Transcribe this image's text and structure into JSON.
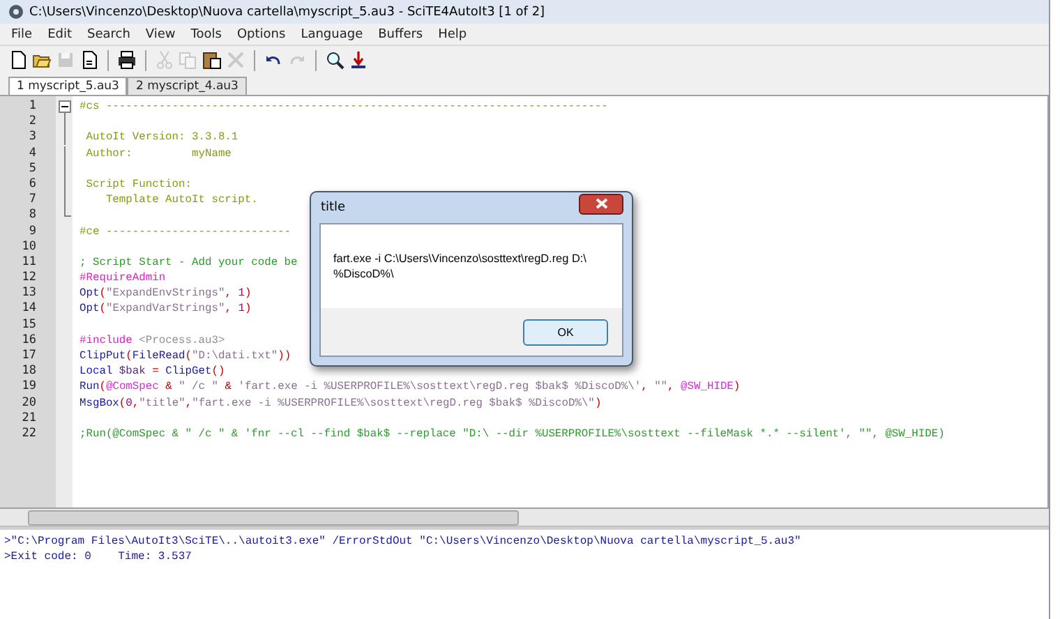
{
  "window": {
    "title": "C:\\Users\\Vincenzo\\Desktop\\Nuova cartella\\myscript_5.au3 - SciTE4AutoIt3 [1 of 2]"
  },
  "menu": [
    "File",
    "Edit",
    "Search",
    "View",
    "Tools",
    "Options",
    "Language",
    "Buffers",
    "Help"
  ],
  "toolbar": [
    {
      "kind": "new",
      "disabled": false
    },
    {
      "kind": "open",
      "disabled": false
    },
    {
      "kind": "save",
      "disabled": true
    },
    {
      "kind": "document",
      "disabled": false
    },
    {
      "kind": "separator"
    },
    {
      "kind": "print",
      "disabled": false
    },
    {
      "kind": "separator"
    },
    {
      "kind": "cut",
      "disabled": true
    },
    {
      "kind": "copy",
      "disabled": true
    },
    {
      "kind": "paste",
      "disabled": false
    },
    {
      "kind": "delete",
      "disabled": true
    },
    {
      "kind": "separator"
    },
    {
      "kind": "undo",
      "disabled": false
    },
    {
      "kind": "redo",
      "disabled": true
    },
    {
      "kind": "separator"
    },
    {
      "kind": "find",
      "disabled": false
    },
    {
      "kind": "compile",
      "disabled": false
    }
  ],
  "tabs": [
    {
      "label": "1 myscript_5.au3",
      "selected": true
    },
    {
      "label": "2 myscript_4.au3",
      "selected": false
    }
  ],
  "editor": {
    "lines": [
      {
        "number": "1",
        "kind": "fold_start",
        "expanded": true,
        "segments": [
          {
            "kind": "block",
            "text": "#cs ----------------------------------------------------------------------------"
          }
        ]
      },
      {
        "number": "2",
        "kind": "fold_body"
      },
      {
        "number": "3",
        "kind": "fold_body",
        "segments": [
          {
            "kind": "block",
            "text": " AutoIt Version: 3.3.8.1"
          }
        ]
      },
      {
        "number": "4",
        "kind": "fold_body",
        "segments": [
          {
            "kind": "block",
            "text": " Author:         myName"
          }
        ]
      },
      {
        "number": "5",
        "kind": "fold_body"
      },
      {
        "number": "6",
        "kind": "fold_body",
        "segments": [
          {
            "kind": "block",
            "text": " Script Function:"
          }
        ]
      },
      {
        "number": "7",
        "kind": "fold_body",
        "segments": [
          {
            "kind": "block",
            "text": "    Template AutoIt script."
          }
        ]
      },
      {
        "number": "8",
        "kind": "fold_end"
      },
      {
        "number": "9",
        "kind": "plain",
        "segments": [
          {
            "kind": "block",
            "text": "#ce ----------------------------"
          }
        ]
      },
      {
        "number": "10",
        "kind": "plain"
      },
      {
        "number": "11",
        "kind": "plain",
        "segments": [
          {
            "kind": "comment",
            "text": "; Script Start - Add your code be"
          }
        ]
      },
      {
        "number": "12",
        "kind": "plain",
        "segments": [
          {
            "kind": "directive",
            "text": "#RequireAdmin"
          }
        ]
      },
      {
        "number": "13",
        "kind": "plain",
        "segments": [
          {
            "kind": "func",
            "text": "Opt"
          },
          {
            "kind": "op",
            "text": "("
          },
          {
            "kind": "string",
            "text": "\"ExpandEnvStrings\""
          },
          {
            "kind": "op",
            "text": ", "
          },
          {
            "kind": "number",
            "text": "1"
          },
          {
            "kind": "op",
            "text": ")"
          }
        ]
      },
      {
        "number": "14",
        "kind": "plain",
        "segments": [
          {
            "kind": "func",
            "text": "Opt"
          },
          {
            "kind": "op",
            "text": "("
          },
          {
            "kind": "string",
            "text": "\"ExpandVarStrings\""
          },
          {
            "kind": "op",
            "text": ", "
          },
          {
            "kind": "number",
            "text": "1"
          },
          {
            "kind": "op",
            "text": ")"
          }
        ]
      },
      {
        "number": "15",
        "kind": "plain"
      },
      {
        "number": "16",
        "kind": "plain",
        "segments": [
          {
            "kind": "directive",
            "text": "#include "
          },
          {
            "kind": "include",
            "text": "<Process.au3>"
          }
        ]
      },
      {
        "number": "17",
        "kind": "plain",
        "segments": [
          {
            "kind": "func",
            "text": "ClipPut"
          },
          {
            "kind": "op",
            "text": "("
          },
          {
            "kind": "func",
            "text": "FileRead"
          },
          {
            "kind": "op",
            "text": "("
          },
          {
            "kind": "string",
            "text": "\"D:\\dati.txt\""
          },
          {
            "kind": "op",
            "text": "))"
          }
        ]
      },
      {
        "number": "18",
        "kind": "plain",
        "segments": [
          {
            "kind": "keyword",
            "text": "Local "
          },
          {
            "kind": "variable",
            "text": "$bak"
          },
          {
            "kind": "op",
            "text": " = "
          },
          {
            "kind": "func",
            "text": "ClipGet"
          },
          {
            "kind": "op",
            "text": "()"
          }
        ]
      },
      {
        "number": "19",
        "kind": "plain",
        "segments": [
          {
            "kind": "func",
            "text": "Run"
          },
          {
            "kind": "op",
            "text": "("
          },
          {
            "kind": "macro",
            "text": "@ComSpec"
          },
          {
            "kind": "op",
            "text": " & "
          },
          {
            "kind": "string",
            "text": "\" /c \""
          },
          {
            "kind": "op",
            "text": " & "
          },
          {
            "kind": "string",
            "text": "'fart.exe -i %USERPROFILE%\\sosttext\\regD.reg $bak$ %DiscoD%\\'"
          },
          {
            "kind": "op",
            "text": ", "
          },
          {
            "kind": "string",
            "text": "\"\""
          },
          {
            "kind": "op",
            "text": ", "
          },
          {
            "kind": "macro",
            "text": "@SW_HIDE"
          },
          {
            "kind": "op",
            "text": ")"
          }
        ]
      },
      {
        "number": "20",
        "kind": "plain",
        "segments": [
          {
            "kind": "func",
            "text": "MsgBox"
          },
          {
            "kind": "op",
            "text": "("
          },
          {
            "kind": "number",
            "text": "0"
          },
          {
            "kind": "op",
            "text": ","
          },
          {
            "kind": "string",
            "text": "\"title\""
          },
          {
            "kind": "op",
            "text": ","
          },
          {
            "kind": "string",
            "text": "\"fart.exe -i %USERPROFILE%\\sosttext\\regD.reg $bak$ %DiscoD%\\\""
          },
          {
            "kind": "op",
            "text": ")"
          }
        ]
      },
      {
        "number": "21",
        "kind": "plain"
      },
      {
        "number": "22",
        "kind": "plain",
        "segments": [
          {
            "kind": "comment",
            "text": ";Run(@ComSpec & \" /c \" & 'fnr --cl --find $bak$ --replace \"D:\\ --dir %USERPROFILE%\\sosttext --fileMask *.* --silent', \"\", @SW_HIDE)"
          }
        ]
      }
    ]
  },
  "output": [
    ">\"C:\\Program Files\\AutoIt3\\SciTE\\..\\autoit3.exe\" /ErrorStdOut \"C:\\Users\\Vincenzo\\Desktop\\Nuova cartella\\myscript_5.au3\"",
    ">Exit code: 0    Time: 3.537"
  ],
  "dialog": {
    "title": "title",
    "message_lines": [
      "fart.exe -i C:\\Users\\Vincenzo\\sosttext\\regD.reg D:\\",
      "%DiscoD%\\"
    ],
    "button": "OK"
  }
}
